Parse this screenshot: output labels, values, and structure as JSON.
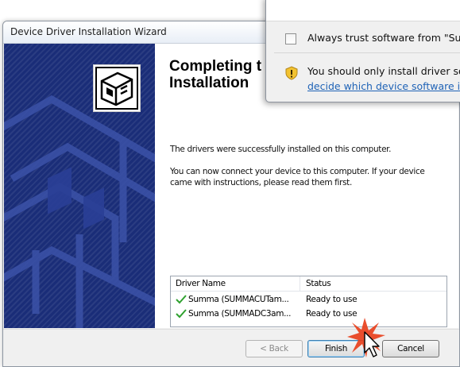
{
  "wizard": {
    "title": "Device Driver Installation Wizard",
    "heading": "Completing t\nInstallation",
    "message_success": "The drivers were successfully installed on this computer.",
    "message_connect": "You can now connect your device to this computer. If your device came with instructions, please read them first.",
    "table": {
      "headers": {
        "name": "Driver Name",
        "status": "Status"
      },
      "rows": [
        {
          "name": "Summa (SUMMACUTam...",
          "status": "Ready to use",
          "icon": "green-check-icon"
        },
        {
          "name": "Summa (SUMMADC3am...",
          "status": "Ready to use",
          "icon": "green-check-icon"
        }
      ]
    },
    "buttons": {
      "back": "< Back",
      "finish": "Finish",
      "cancel": "Cancel"
    }
  },
  "security_popup": {
    "trust_label": "Always trust software from \"Su",
    "warning_text": "You should only install driver so",
    "warning_link": "decide which device software is"
  },
  "colors": {
    "banner": "#1a2d78",
    "check": "#2fa12f",
    "link": "#1e62b6",
    "finish_border": "#3c7fb1",
    "cursor_burst": "#e8401c"
  }
}
